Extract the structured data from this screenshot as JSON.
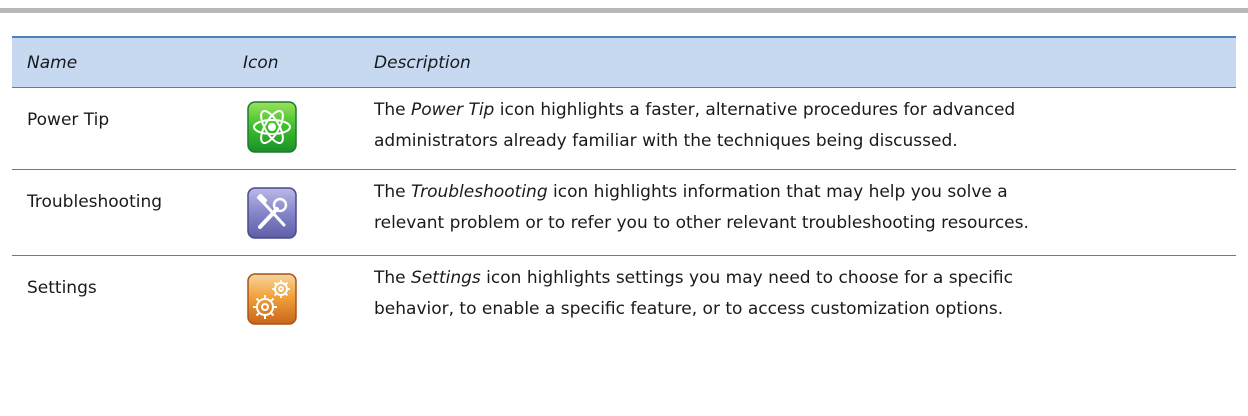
{
  "table": {
    "headers": {
      "name": "Name",
      "icon": "Icon",
      "description": "Description"
    },
    "rows": [
      {
        "name": "Power Tip",
        "icon": "power-tip-atom-icon",
        "desc_prefix": "The ",
        "desc_term": "Power Tip",
        "desc_line1_rest": " icon highlights a faster, alternative procedures for advanced",
        "desc_line2": "administrators already familiar with the techniques being discussed."
      },
      {
        "name": "Troubleshooting",
        "icon": "troubleshooting-tools-icon",
        "desc_prefix": "The ",
        "desc_term": "Troubleshooting",
        "desc_line1_rest": " icon highlights information that may help you solve a",
        "desc_line2": "relevant problem or to refer you to other relevant troubleshooting resources."
      },
      {
        "name": "Settings",
        "icon": "settings-gears-icon",
        "desc_prefix": "The ",
        "desc_term": "Settings",
        "desc_line1_rest": " icon highlights settings you may need to choose for a specific",
        "desc_line2": "behavior, to enable a specific feature, or to access customization options."
      }
    ]
  },
  "colors": {
    "header_bg": "#c6d9f1",
    "rule": "#4f81bd",
    "top_rule": "#b8b8b8"
  }
}
